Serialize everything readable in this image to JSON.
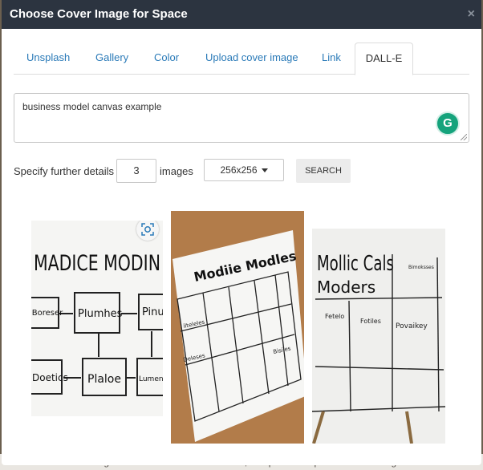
{
  "background_text": "ices in real-time. It can gather data from various sensors, interpret it and provide useful insights for the",
  "modal": {
    "title": "Choose Cover Image for Space",
    "close_icon": "×"
  },
  "tabs": [
    {
      "label": "Unsplash",
      "active": false
    },
    {
      "label": "Gallery",
      "active": false
    },
    {
      "label": "Color",
      "active": false
    },
    {
      "label": "Upload cover image",
      "active": false
    },
    {
      "label": "Link",
      "active": false
    },
    {
      "label": "DALL-E",
      "active": true
    }
  ],
  "prompt": {
    "value": "business model canvas example",
    "grammarly_letter": "G"
  },
  "controls": {
    "details_label": "Specify further details",
    "count_value": "3",
    "images_label": "images",
    "size_value": "256x256",
    "search_label": "SEARCH"
  },
  "results": [
    {
      "heading": "MADICE MODIN",
      "boxes": [
        "Plumhes",
        "Plaloe",
        "Pinus",
        "Doetics",
        "lBoreser",
        "Lumenal"
      ]
    },
    {
      "heading": "Modiie Modles",
      "boxes": [
        "ilteleles",
        "Deleses",
        "Bisiles"
      ]
    },
    {
      "heading": "Mollic Cals",
      "subheading": "Moders",
      "boxes": [
        "Fetelo",
        "Fotiles",
        "Povaikey",
        "Bimoksses"
      ]
    }
  ],
  "colors": {
    "header_bg": "#2c3440",
    "link": "#2a7ab8",
    "grammarly": "#15a37c"
  }
}
